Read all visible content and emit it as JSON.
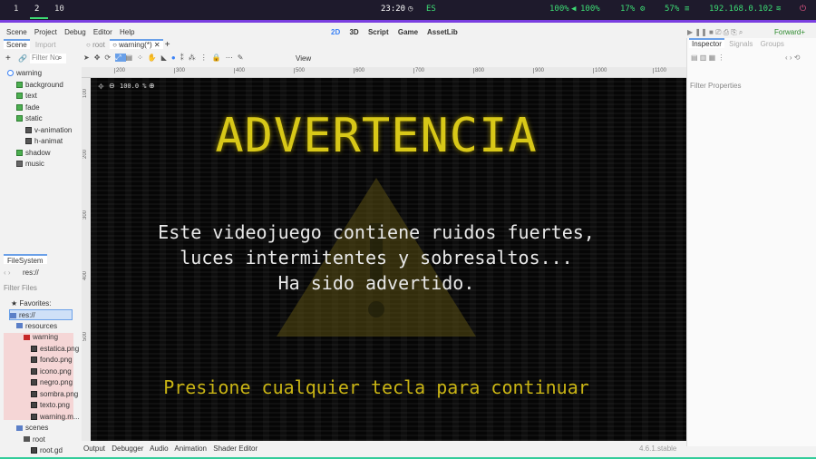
{
  "topbar": {
    "workspaces": [
      "1",
      "2",
      "10"
    ],
    "clock": "23:20",
    "lang": "ES",
    "volume": "100%",
    "mic": "100%",
    "cpu": "17%",
    "mem": "57%",
    "ip": "192.168.0.102"
  },
  "menu": [
    "Scene",
    "Project",
    "Debug",
    "Editor",
    "Help"
  ],
  "modes": [
    "2D",
    "3D",
    "Script",
    "Game",
    "AssetLib"
  ],
  "renderer": "Forward+",
  "scene_dock": {
    "tabs": [
      "Scene",
      "Import"
    ],
    "filter_placeholder": "Filter No",
    "nodes": [
      {
        "name": "warning",
        "depth": 0
      },
      {
        "name": "background",
        "depth": 1
      },
      {
        "name": "text",
        "depth": 1
      },
      {
        "name": "fade",
        "depth": 1
      },
      {
        "name": "static",
        "depth": 1
      },
      {
        "name": "v-animation",
        "depth": 2
      },
      {
        "name": "h-animat",
        "depth": 2
      },
      {
        "name": "shadow",
        "depth": 1
      },
      {
        "name": "music",
        "depth": 1
      }
    ]
  },
  "filesystem": {
    "title": "FileSystem",
    "path": "res://",
    "filter_placeholder": "Filter Files",
    "favorites": "Favorites:",
    "items": [
      {
        "name": "res://",
        "depth": 0
      },
      {
        "name": "resources",
        "depth": 1
      },
      {
        "name": "warning",
        "depth": 2
      },
      {
        "name": "estatica.png",
        "depth": 3
      },
      {
        "name": "fondo.png",
        "depth": 3
      },
      {
        "name": "icono.png",
        "depth": 3
      },
      {
        "name": "negro.png",
        "depth": 3
      },
      {
        "name": "sombra.png",
        "depth": 3
      },
      {
        "name": "texto.png",
        "depth": 3
      },
      {
        "name": "warning.m...",
        "depth": 3
      },
      {
        "name": "scenes",
        "depth": 1
      },
      {
        "name": "root",
        "depth": 2
      },
      {
        "name": "root.gd",
        "depth": 3
      }
    ]
  },
  "scene_tabs": [
    "root",
    "warning(*)"
  ],
  "view_menu": "View",
  "zoom": "100.0 %",
  "ruler_ticks": [
    "200",
    "300",
    "400",
    "500",
    "600",
    "700",
    "800",
    "900",
    "1000",
    "1100"
  ],
  "vruler_ticks": [
    "100",
    "200",
    "300",
    "400",
    "500"
  ],
  "game": {
    "title": "ADVERTENCIA",
    "lines": [
      "Este videojuego contiene ruidos fuertes,",
      "luces intermitentes y sobresaltos...",
      "Ha sido advertido."
    ],
    "prompt": "Presione cualquier tecla para continuar"
  },
  "bottom_tabs": [
    "Output",
    "Debugger",
    "Audio",
    "Animation",
    "Shader Editor"
  ],
  "version": "4.6.1.stable",
  "inspector": {
    "tabs": [
      "Inspector",
      "Signals",
      "Groups"
    ],
    "filter_placeholder": "Filter Properties"
  }
}
